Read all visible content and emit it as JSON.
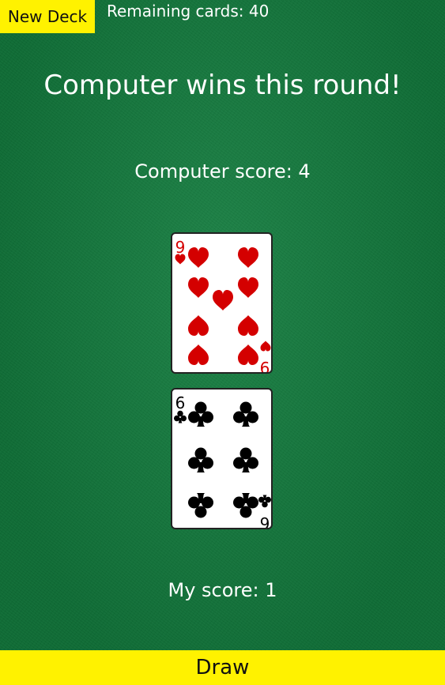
{
  "header": {
    "new_deck_label": "New Deck",
    "remaining_cards": "Remaining cards: 40"
  },
  "round_message": "Computer wins this round!",
  "computer_score": "Computer score: 4",
  "my_score": "My score: 1",
  "cards": {
    "computer": {
      "rank": "9",
      "suit": "hearts",
      "color": "#d40000"
    },
    "player": {
      "rank": "6",
      "suit": "clubs",
      "color": "#000000"
    }
  },
  "draw_label": "Draw",
  "colors": {
    "table_green": "#0f7a3b",
    "button_yellow": "#fff200"
  }
}
